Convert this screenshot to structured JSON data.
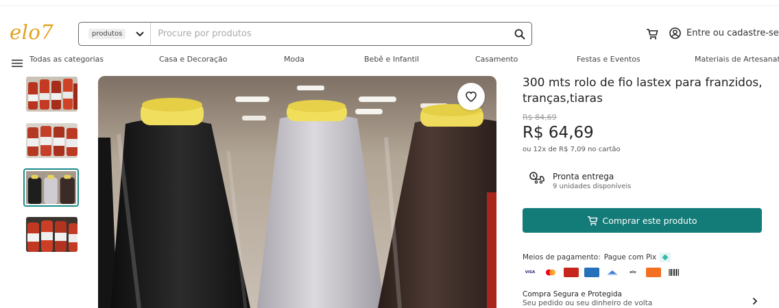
{
  "header": {
    "logo": "elo7",
    "search_scope": "produtos",
    "search_placeholder": "Procure por produtos",
    "login_label": "Entre ou cadastre-se"
  },
  "nav": {
    "all_categories": "Todas as categorias",
    "items": [
      "Casa e Decoração",
      "Moda",
      "Bebê e Infantil",
      "Casamento",
      "Festas e Eventos",
      "Materiais de Artesanato"
    ]
  },
  "product": {
    "title": "300 mts rolo de fio lastex para franzidos, tranças,tiaras",
    "old_price": "R$ 84,69",
    "price": "R$ 64,69",
    "installments": "ou 12x de R$ 7,09 no cartão",
    "stock_title": "Pronta entrega",
    "stock_sub": "9 unidades disponíveis",
    "buy_label": "Comprar este produto",
    "payment_label": "Meios de pagamento:",
    "pix_label": "Pague com Pix",
    "card_brands": [
      "VISA",
      "mastercard",
      "diners",
      "amex",
      "hipercard",
      "elo",
      "hiper",
      "boleto"
    ],
    "secure_title": "Compra Segura e Protegida",
    "secure_sub": "Seu pedido ou seu dinheiro de volta"
  },
  "gallery": {
    "thumbnails": 4,
    "selected_index": 2
  },
  "colors": {
    "brand": "#e2a21a",
    "accent": "#137b78"
  }
}
